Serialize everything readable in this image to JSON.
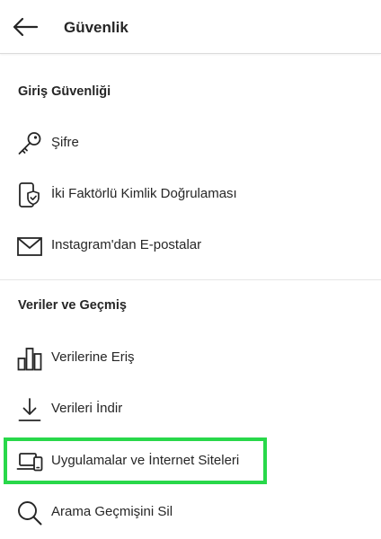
{
  "header": {
    "title": "Güvenlik",
    "back_icon": "back-arrow-icon"
  },
  "sections": [
    {
      "title": "Giriş Güvenliği",
      "items": [
        {
          "label": "Şifre",
          "icon": "key-icon"
        },
        {
          "label": "İki Faktörlü Kimlik Doğrulaması",
          "icon": "phone-shield-icon"
        },
        {
          "label": "Instagram'dan E-postalar",
          "icon": "envelope-icon"
        }
      ]
    },
    {
      "title": "Veriler ve Geçmiş",
      "items": [
        {
          "label": "Verilerine Eriş",
          "icon": "bar-chart-icon"
        },
        {
          "label": "Verileri İndir",
          "icon": "download-icon"
        },
        {
          "label": "Uygulamalar ve İnternet Siteleri",
          "icon": "devices-icon"
        },
        {
          "label": "Arama Geçmişini Sil",
          "icon": "search-icon"
        }
      ]
    }
  ],
  "highlight_color": "#28d84a"
}
